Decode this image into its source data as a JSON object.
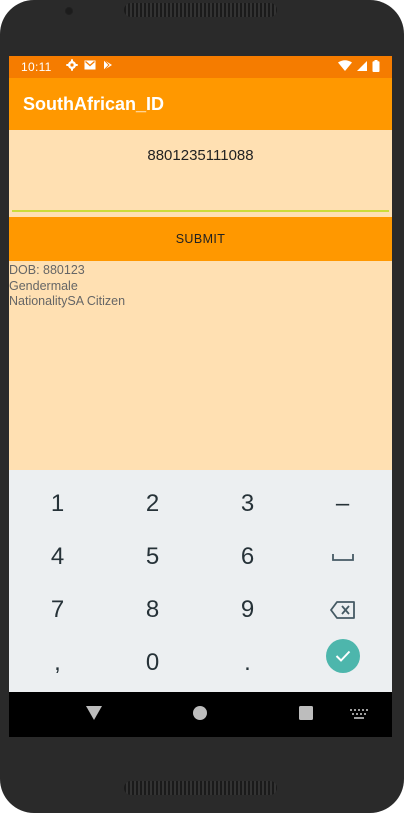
{
  "status_bar": {
    "time": "10:11",
    "left_icons": [
      "gear-icon",
      "gmail-icon",
      "play-store-icon"
    ],
    "right_icons": [
      "wifi-icon",
      "signal-icon",
      "battery-icon"
    ]
  },
  "app_bar": {
    "title": "SouthAfrican_ID"
  },
  "id_field": {
    "value": "8801235111088"
  },
  "submit_label": "SUBMIT",
  "results": {
    "dob": "DOB: 880123",
    "gender": "Gendermale",
    "nationality": "NationalitySA Citizen"
  },
  "keyboard": {
    "keys": [
      [
        "1",
        "2",
        "3",
        "–"
      ],
      [
        "4",
        "5",
        "6",
        "␣"
      ],
      [
        "7",
        "8",
        "9",
        "⌫"
      ],
      [
        ",",
        "0",
        ".",
        "✓"
      ]
    ]
  },
  "colors": {
    "status_bar": "#f57c00",
    "app_bar": "#ff9800",
    "background": "#ffe0b2",
    "input_underline": "#cddc39",
    "keyboard_bg": "#eceff1",
    "done_key": "#4db6ac"
  }
}
